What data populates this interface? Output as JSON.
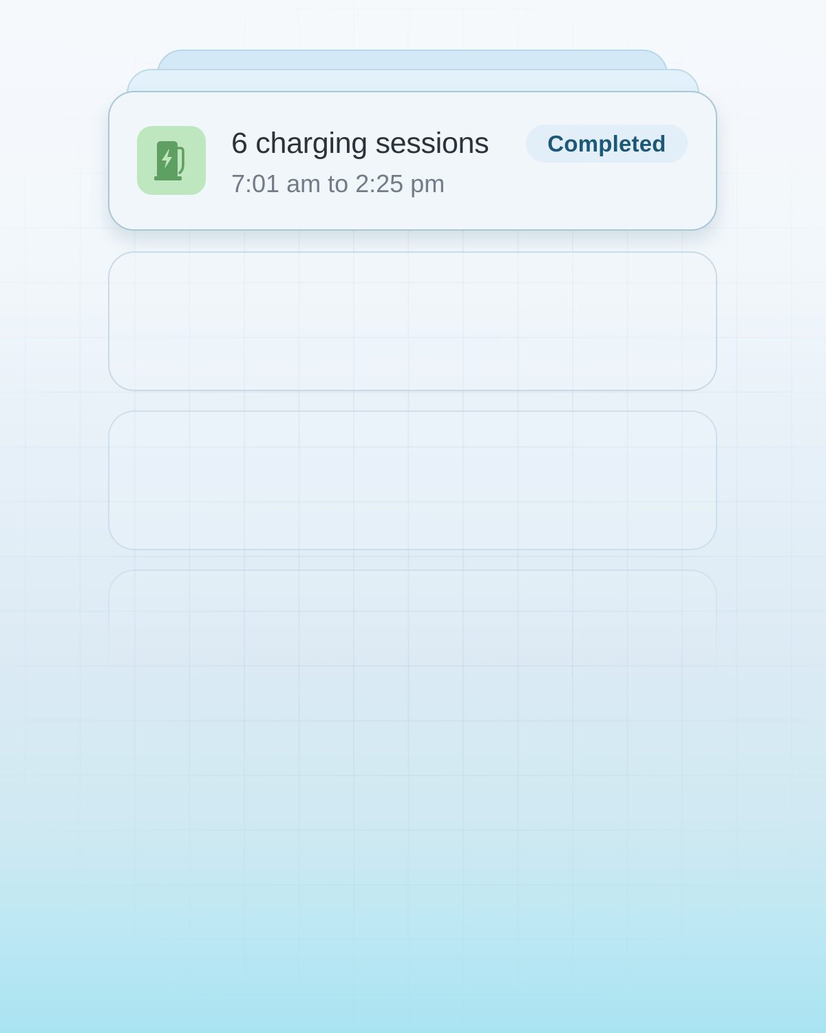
{
  "notification": {
    "title": "6 charging sessions",
    "subtitle": "7:01 am to 2:25 pm",
    "status": "Completed",
    "icon": "ev-charger-icon",
    "colors": {
      "icon_bg": "#bfe7bf",
      "icon_fg": "#5f9f62",
      "badge_bg": "#e2eff8",
      "badge_text": "#1c5878"
    }
  }
}
